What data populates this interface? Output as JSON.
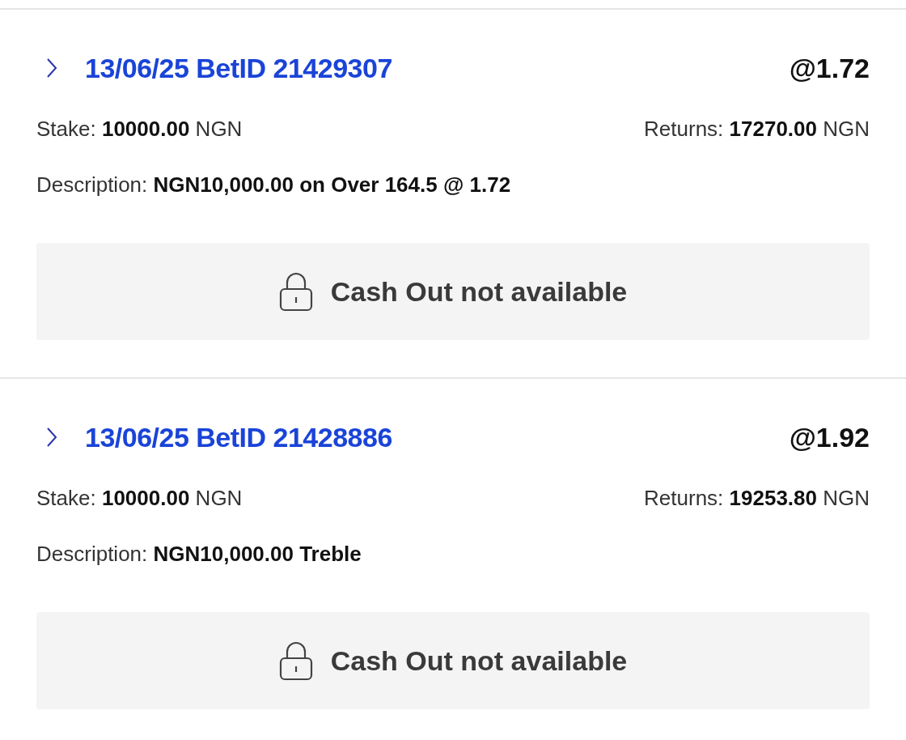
{
  "bets": [
    {
      "title": "13/06/25 BetID 21429307",
      "expanded": false,
      "odds": "@1.72",
      "stake": "Stake: **10000.00** NGN",
      "returns": "Returns: **17270.00** NGN",
      "description": "Description: **NGN10,000.00 on Over 164.5 @ 1.72**",
      "cash_out": {
        "label": "Cash Out not available",
        "locked": true
      }
    },
    {
      "title": "13/06/25 BetID 21428886",
      "expanded": false,
      "odds": "@1.92",
      "stake": "Stake: **10000.00** NGN",
      "returns": "Returns: **19253.80** NGN",
      "description": "Description: **NGN10,000.00 Treble**",
      "cash_out": {
        "label": "Cash Out not available",
        "locked": true
      }
    }
  ]
}
